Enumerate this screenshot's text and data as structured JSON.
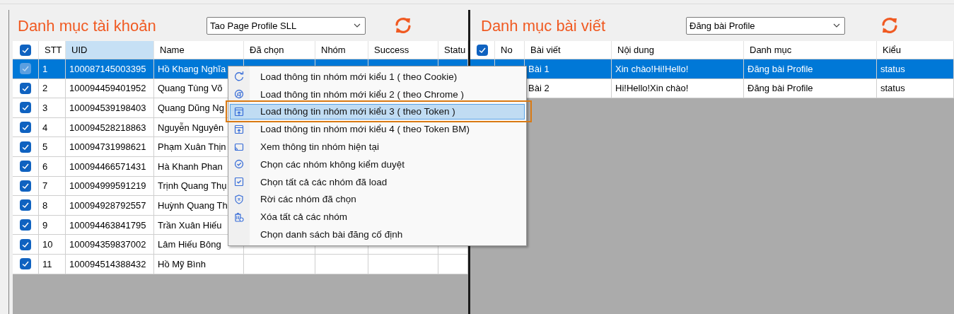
{
  "accounts": {
    "title": "Danh mục tài khoản",
    "combo": {
      "value": "Tao Page Profile SLL"
    },
    "table": {
      "header_checked": true,
      "columns": [
        {
          "label": "STT",
          "highlighted": false
        },
        {
          "label": "UID",
          "highlighted": true
        },
        {
          "label": "Name",
          "highlighted": false
        },
        {
          "label": "Đã chọn",
          "highlighted": false
        },
        {
          "label": "Nhóm",
          "highlighted": false
        },
        {
          "label": "Success",
          "highlighted": false
        },
        {
          "label": "Statu",
          "highlighted": false
        }
      ],
      "rows": [
        {
          "checked": true,
          "selected": true,
          "cells": [
            "1",
            "100087145003395",
            "Hồ Khang Nghĩa"
          ]
        },
        {
          "checked": true,
          "selected": false,
          "cells": [
            "2",
            "100094459401952",
            "Quang Tùng Võ"
          ]
        },
        {
          "checked": true,
          "selected": false,
          "cells": [
            "3",
            "100094539198403",
            "Quang Dũng Ng"
          ]
        },
        {
          "checked": true,
          "selected": false,
          "cells": [
            "4",
            "100094528218863",
            "Nguyễn Nguyên"
          ]
        },
        {
          "checked": true,
          "selected": false,
          "cells": [
            "5",
            "100094731998621",
            "Phạm Xuân Thịn"
          ]
        },
        {
          "checked": true,
          "selected": false,
          "cells": [
            "6",
            "100094466571431",
            "Hà Khanh Phan"
          ]
        },
        {
          "checked": true,
          "selected": false,
          "cells": [
            "7",
            "100094999591219",
            "Trịnh Quang Thụ"
          ]
        },
        {
          "checked": true,
          "selected": false,
          "cells": [
            "8",
            "100094928792557",
            "Huỳnh Quang Th"
          ]
        },
        {
          "checked": true,
          "selected": false,
          "cells": [
            "9",
            "100094463841795",
            "Trần Xuân Hiếu"
          ]
        },
        {
          "checked": true,
          "selected": false,
          "cells": [
            "10",
            "100094359837002",
            "Lâm Hiếu Bông"
          ]
        },
        {
          "checked": true,
          "selected": false,
          "cells": [
            "11",
            "100094514388432",
            "Hồ Mỹ Bình"
          ]
        }
      ]
    }
  },
  "posts": {
    "title": "Danh mục bài viết",
    "combo": {
      "value": "Đăng bài Profile"
    },
    "table": {
      "header_checked": true,
      "columns": [
        {
          "label": "No",
          "highlighted": false
        },
        {
          "label": "Bài viết",
          "highlighted": false
        },
        {
          "label": "Nội dung",
          "highlighted": false
        },
        {
          "label": "Danh mục",
          "highlighted": false
        },
        {
          "label": "Kiểu",
          "highlighted": false
        }
      ],
      "rows": [
        {
          "selected": true,
          "cells": [
            "",
            "Bài 1",
            "Xin chào!Hi!Hello!",
            "Đăng bài Profile",
            "status"
          ]
        },
        {
          "selected": false,
          "cells": [
            "",
            "Bài 2",
            "Hi!Hello!Xin chào!",
            "Đăng bài Profile",
            "status"
          ]
        }
      ]
    }
  },
  "context_menu": {
    "items": [
      {
        "label": "Load thông tin nhóm mới kiểu 1 ( theo Cookie)",
        "kind": "refresh",
        "selected": false,
        "outlined": false
      },
      {
        "label": "Load thông tin nhóm mới kiểu 2 ( theo Chrome )",
        "kind": "chrome",
        "selected": false,
        "outlined": false
      },
      {
        "label": "Load thông tin nhóm mới kiểu 3 ( theo Token )",
        "kind": "upload",
        "selected": true,
        "outlined": true
      },
      {
        "label": "Load thông tin nhóm mới kiểu 4 ( theo Token BM)",
        "kind": "upload",
        "selected": false,
        "outlined": false
      },
      {
        "label": "Xem thông tin nhóm hiện tại",
        "kind": "cast",
        "selected": false,
        "outlined": false
      },
      {
        "label": "Chọn các nhóm không kiểm duyệt",
        "kind": "check-circle",
        "selected": false,
        "outlined": false
      },
      {
        "label": "Chọn tất cả các nhóm đã load",
        "kind": "checkbox",
        "selected": false,
        "outlined": false
      },
      {
        "label": "Rời các nhóm đã chọn",
        "kind": "shield",
        "selected": false,
        "outlined": false
      },
      {
        "label": "Xóa tất cả các nhóm",
        "kind": "trash",
        "selected": false,
        "outlined": false
      },
      {
        "label": "Chọn danh sách bài đăng cố định",
        "kind": "plain",
        "selected": false,
        "outlined": false
      }
    ]
  }
}
